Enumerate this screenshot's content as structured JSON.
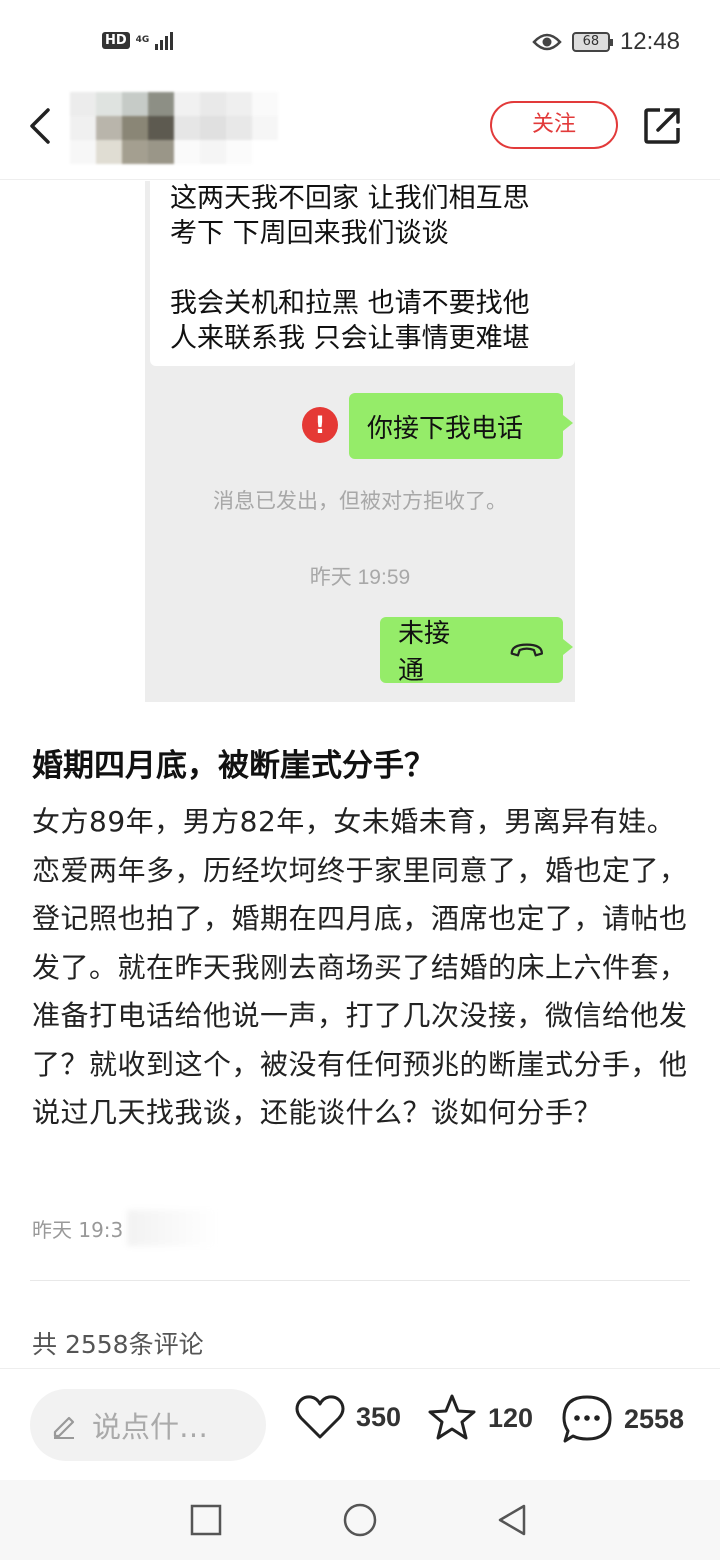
{
  "status_bar": {
    "hd": "HD",
    "network": "4G",
    "battery": "68",
    "time": "12:48"
  },
  "header": {
    "follow_label": "关注"
  },
  "chat": {
    "incoming_lines_1": [
      "这两天我不回家 让我们相互思",
      "考下 下周回来我们谈谈"
    ],
    "incoming_lines_2": [
      "我会关机和拉黑 也请不要找他",
      "人来联系我 只会让事情更难堪"
    ],
    "error_mark": "!",
    "outgoing_message": "你接下我电话",
    "rejected_notice": "消息已发出，但被对方拒收了。",
    "timestamp": "昨天 19:59",
    "call_status": "未接通"
  },
  "post": {
    "title": "婚期四月底，被断崖式分手？",
    "body": "女方89年，男方82年，女未婚未育，男离异有娃。恋爱两年多，历经坎坷终于家里同意了，婚也定了，登记照也拍了，婚期在四月底，酒席也定了，请帖也发了。就在昨天我刚去商场买了结婚的床上六件套，准备打电话给他说一声，打了几次没接，微信给他发了？就收到这个，被没有任何预兆的断崖式分手，他说过几天找我谈，还能谈什么？谈如何分手？",
    "time": "昨天 19:3"
  },
  "comments": {
    "count_label": "共 2558条评论"
  },
  "actions": {
    "input_placeholder": "说点什…",
    "likes": "350",
    "favorites": "120",
    "comments": "2558"
  },
  "colors": {
    "accent": "#e23a3a",
    "bubble": "#95ec69",
    "chat_bg": "#ededed"
  }
}
